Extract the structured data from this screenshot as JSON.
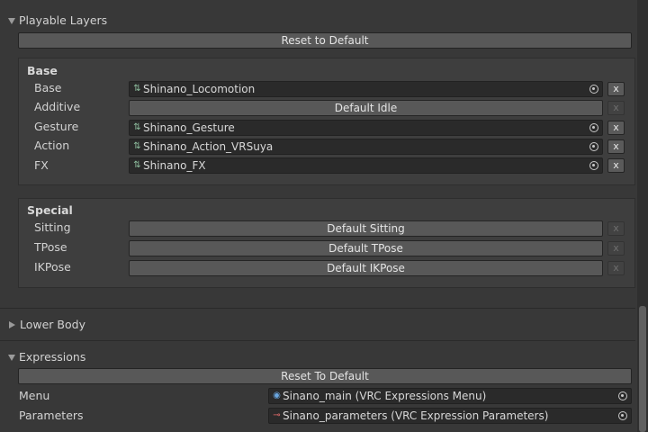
{
  "playable_layers": {
    "title": "Playable Layers",
    "reset_label": "Reset to Default",
    "base": {
      "header": "Base",
      "rows": [
        {
          "label": "Base",
          "value": "Shinano_Locomotion",
          "is_field": true,
          "x_enabled": true
        },
        {
          "label": "Additive",
          "value": "Default Idle",
          "is_field": false,
          "x_enabled": false
        },
        {
          "label": "Gesture",
          "value": "Shinano_Gesture",
          "is_field": true,
          "x_enabled": true
        },
        {
          "label": "Action",
          "value": "Shinano_Action_VRSuya",
          "is_field": true,
          "x_enabled": true
        },
        {
          "label": "FX",
          "value": "Shinano_FX",
          "is_field": true,
          "x_enabled": true
        }
      ]
    },
    "special": {
      "header": "Special",
      "rows": [
        {
          "label": "Sitting",
          "value": "Default Sitting",
          "is_field": false,
          "x_enabled": false
        },
        {
          "label": "TPose",
          "value": "Default TPose",
          "is_field": false,
          "x_enabled": false
        },
        {
          "label": "IKPose",
          "value": "Default IKPose",
          "is_field": false,
          "x_enabled": false
        }
      ]
    },
    "x_label": "x"
  },
  "lower_body": {
    "title": "Lower Body"
  },
  "expressions": {
    "title": "Expressions",
    "reset_label": "Reset To Default",
    "menu_label": "Menu",
    "menu_value": "Sinano_main (VRC Expressions Menu)",
    "params_label": "Parameters",
    "params_value": "Sinano_parameters (VRC Expression Parameters)"
  },
  "icons": {
    "animator": "animator-controller-icon",
    "menu": "expressions-menu-icon",
    "params": "expression-parameters-icon",
    "picker": "object-picker-icon"
  }
}
